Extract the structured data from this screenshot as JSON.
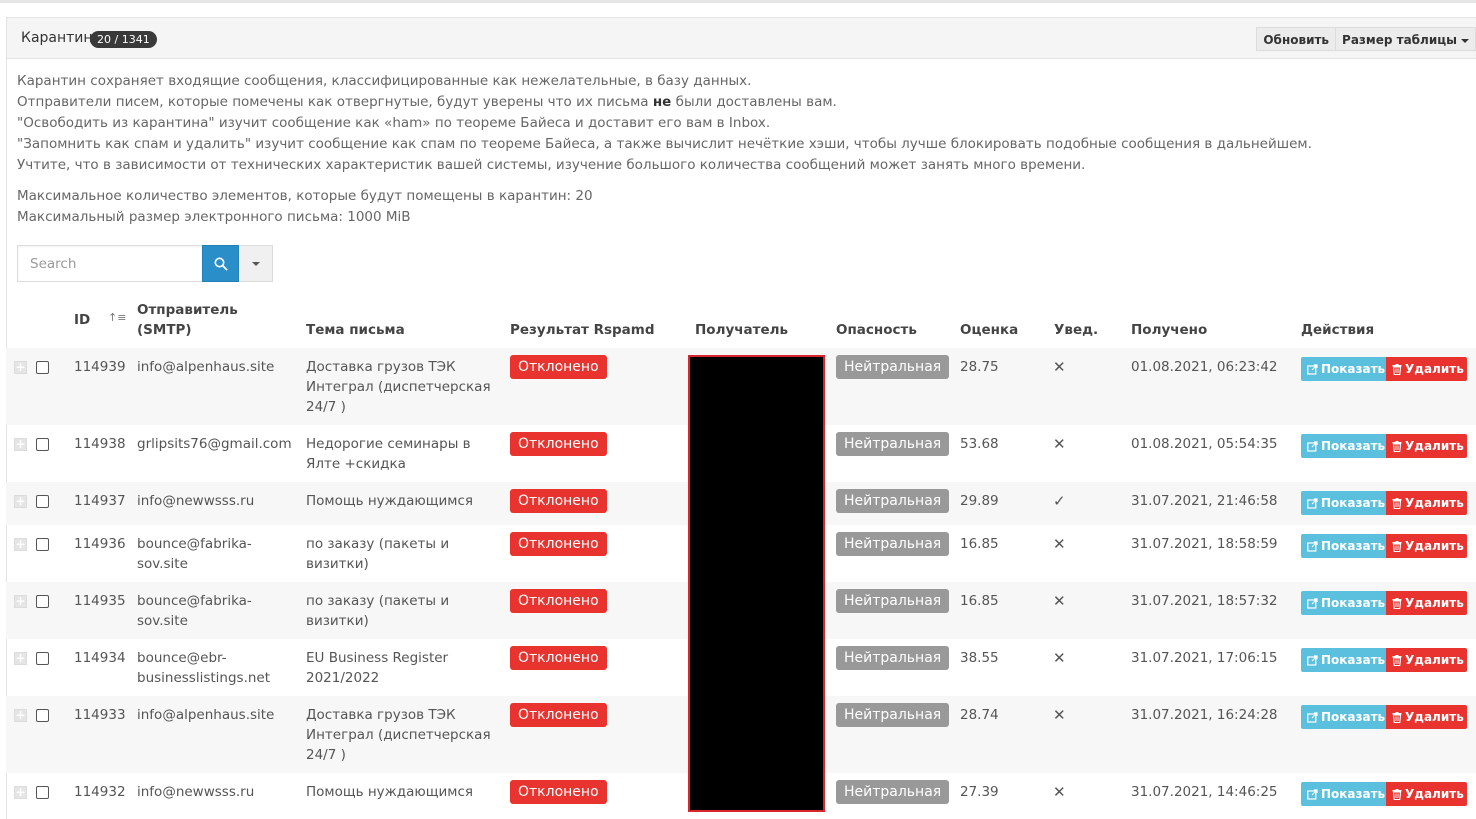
{
  "header": {
    "title": "Карантин",
    "badge": "20 / 1341",
    "refresh_label": "Обновить",
    "table_size_label": "Размер таблицы"
  },
  "description": {
    "line1": "Карантин сохраняет входящие сообщения, классифицированные как нежелательные, в базу данных.",
    "line2_pre": "Отправители писем, которые помечены как отвергнутые, будут уверены что их письма ",
    "line2_bold": "не",
    "line2_post": " были доставлены вам.",
    "line3": "\"Освободить из карантина\" изучит сообщение как «ham» по теореме Байеса и доставит его вам в Inbox.",
    "line4": "\"Запомнить как спам и удалить\" изучит сообщение как спам по теореме Байеса, а также вычислит нечёткие хэши, чтобы лучше блокировать подобные сообщения в дальнейшем.",
    "line5": "Учтите, что в зависимости от технических характеристик вашей системы, изучение большого количества сообщений может занять много времени."
  },
  "limits": {
    "max_items": "Максимальное количество элементов, которые будут помещены в карантин: 20",
    "max_size": "Максимальный размер электронного письма: 1000 MiB"
  },
  "search": {
    "placeholder": "Search"
  },
  "table": {
    "headers": {
      "id": "ID",
      "sender_line1": "Отправитель",
      "sender_line2": "(SMTP)",
      "subject": "Тема письма",
      "result": "Результат Rspamd",
      "recipient": "Получатель",
      "danger": "Опасность",
      "score": "Оценка",
      "notify": "Увед.",
      "received": "Получено",
      "actions": "Действия"
    },
    "show_label": "Показать",
    "delete_label": "Удалить",
    "rows": [
      {
        "id": "114939",
        "sender": [
          "info@alpenhaus.site"
        ],
        "subject": [
          "Доставка грузов ТЭК",
          "Интеграл (диспетчерская",
          "24/7 )"
        ],
        "result": "Отклонено",
        "danger": "Нейтральная",
        "score": "28.75",
        "notify": "✕",
        "received": "01.08.2021, 06:23:42"
      },
      {
        "id": "114938",
        "sender": [
          "grlipsits76@gmail.com"
        ],
        "subject": [
          "Недорогие семинары в",
          "Ялте +скидка"
        ],
        "result": "Отклонено",
        "danger": "Нейтральная",
        "score": "53.68",
        "notify": "✕",
        "received": "01.08.2021, 05:54:35"
      },
      {
        "id": "114937",
        "sender": [
          "info@newwsss.ru"
        ],
        "subject": [
          "Помощь нуждающимся"
        ],
        "result": "Отклонено",
        "danger": "Нейтральная",
        "score": "29.89",
        "notify": "✓",
        "received": "31.07.2021, 21:46:58"
      },
      {
        "id": "114936",
        "sender": [
          "bounce@fabrika-",
          "sov.site"
        ],
        "subject": [
          "по заказу (пакеты и",
          "визитки)"
        ],
        "result": "Отклонено",
        "danger": "Нейтральная",
        "score": "16.85",
        "notify": "✕",
        "received": "31.07.2021, 18:58:59"
      },
      {
        "id": "114935",
        "sender": [
          "bounce@fabrika-",
          "sov.site"
        ],
        "subject": [
          "по заказу (пакеты и",
          "визитки)"
        ],
        "result": "Отклонено",
        "danger": "Нейтральная",
        "score": "16.85",
        "notify": "✕",
        "received": "31.07.2021, 18:57:32"
      },
      {
        "id": "114934",
        "sender": [
          "bounce@ebr-",
          "businesslistings.net"
        ],
        "subject": [
          "EU Business Register",
          "2021/2022"
        ],
        "result": "Отклонено",
        "danger": "Нейтральная",
        "score": "38.55",
        "notify": "✕",
        "received": "31.07.2021, 17:06:15"
      },
      {
        "id": "114933",
        "sender": [
          "info@alpenhaus.site"
        ],
        "subject": [
          "Доставка грузов ТЭК",
          "Интеграл (диспетчерская",
          "24/7 )"
        ],
        "result": "Отклонено",
        "danger": "Нейтральная",
        "score": "28.74",
        "notify": "✕",
        "received": "31.07.2021, 16:24:28"
      },
      {
        "id": "114932",
        "sender": [
          "info@newwsss.ru"
        ],
        "subject": [
          "Помощь нуждающимся"
        ],
        "result": "Отклонено",
        "danger": "Нейтральная",
        "score": "27.39",
        "notify": "✕",
        "received": "31.07.2021, 14:46:25"
      }
    ]
  }
}
